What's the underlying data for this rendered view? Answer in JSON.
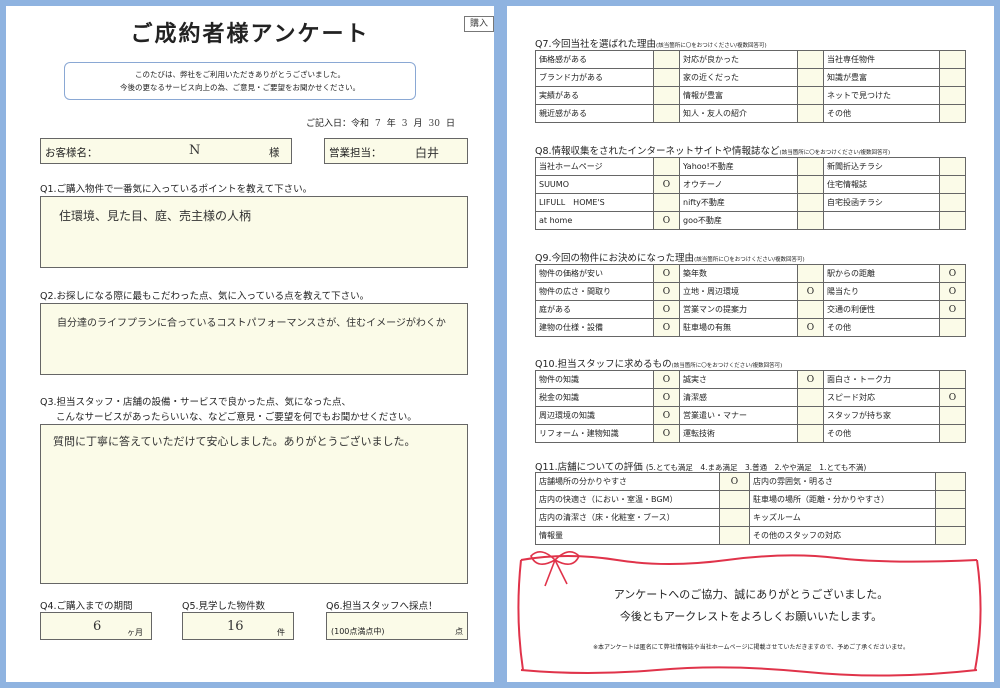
{
  "left": {
    "title": "ご成約者様アンケート",
    "tag": "購入",
    "intro": [
      "このたびは、弊社をご利用いただきありがとうございました。",
      "今後の更なるサービス向上の為、ご意見・ご要望をお聞かせください。"
    ],
    "date": {
      "label": "ご記入日：令和",
      "year": "7",
      "year_unit": "年",
      "month": "3",
      "month_unit": "月",
      "day": "30",
      "day_unit": "日"
    },
    "customer": {
      "label": "お客様名：",
      "value": "N",
      "suffix": "様"
    },
    "sales": {
      "label": "営業担当：",
      "value": "白井"
    },
    "q1": {
      "label": "Q1.ご購入物件で一番気に入っているポイントを教えて下さい。",
      "answer": "住環境、見た目、庭、売主様の人柄"
    },
    "q2": {
      "label": "Q2.お探しになる際に最もこだわった点、気に入っている点を教えて下さい。",
      "answer": "自分達のライフプランに合っているコストパフォーマンスさが、住むイメージがわくか"
    },
    "q3": {
      "label1": "Q3.担当スタッフ・店舗の設備・サービスで良かった点、気になった点、",
      "label2": "こんなサービスがあったらいいな、などご意見・ご要望を何でもお聞かせください。",
      "answer": "質問に丁寧に答えていただけて安心しました。ありがとうございました。"
    },
    "q4": {
      "label": "Q4.ご購入までの期間",
      "value": "6",
      "unit": "ヶ月"
    },
    "q5": {
      "label": "Q5.見学した物件数",
      "value": "16",
      "unit": "件"
    },
    "q6": {
      "label": "Q6.担当スタッフへ採点！",
      "note": "(100点満点中)",
      "unit": "点"
    }
  },
  "right": {
    "q7": {
      "title": "Q7.今回当社を選ばれた理由",
      "note": "(該当箇所に〇をおつけください/複数回答可)",
      "rows": [
        [
          "価格感がある",
          "",
          "対応が良かった",
          "",
          "当社専任物件",
          ""
        ],
        [
          "ブランド力がある",
          "",
          "家の近くだった",
          "",
          "知識が豊富",
          ""
        ],
        [
          "実績がある",
          "",
          "情報が豊富",
          "",
          "ネットで見つけた",
          ""
        ],
        [
          "親近感がある",
          "",
          "知人・友人の紹介",
          "",
          "その他",
          ""
        ]
      ]
    },
    "q8": {
      "title": "Q8.情報収集をされたインターネットサイトや情報誌など",
      "note": "(該当箇所に〇をおつけください/複数回答可)",
      "rows": [
        [
          "当社ホームページ",
          "",
          "Yahoo!不動産",
          "",
          "新聞折込チラシ",
          ""
        ],
        [
          "SUUMO",
          "O",
          "オウチーノ",
          "",
          "住宅情報誌",
          ""
        ],
        [
          "LIFULL　HOME'S",
          "",
          "nifty不動産",
          "",
          "自宅投函チラシ",
          ""
        ],
        [
          "at home",
          "O",
          "goo不動産",
          "",
          "",
          ""
        ]
      ]
    },
    "q9": {
      "title": "Q9.今回の物件にお決めになった理由",
      "note": "(該当箇所に〇をおつけください/複数回答可)",
      "rows": [
        [
          "物件の価格が安い",
          "O",
          "築年数",
          "",
          "駅からの距離",
          "O"
        ],
        [
          "物件の広さ・間取り",
          "O",
          "立地・周辺環境",
          "O",
          "陽当たり",
          "O"
        ],
        [
          "庭がある",
          "O",
          "営業マンの提案力",
          "",
          "交通の利便性",
          "O"
        ],
        [
          "建物の仕様・設備",
          "O",
          "駐車場の有無",
          "O",
          "その他",
          ""
        ]
      ]
    },
    "q10": {
      "title": "Q10.担当スタッフに求めるもの",
      "note": "(該当箇所に〇をおつけください/複数回答可)",
      "rows": [
        [
          "物件の知識",
          "O",
          "誠実さ",
          "O",
          "面白さ・トーク力",
          ""
        ],
        [
          "税金の知識",
          "O",
          "清潔感",
          "",
          "スピード対応",
          "O"
        ],
        [
          "周辺環境の知識",
          "O",
          "営業遣い・マナー",
          "",
          "スタッフが持ち家",
          ""
        ],
        [
          "リフォーム・建物知識",
          "O",
          "運転技術",
          "",
          "その他",
          ""
        ]
      ]
    },
    "q11": {
      "title": "Q11.店舗についての評価",
      "scale": "(5.とても満足　4.まあ満足　3.普通　2.やや満足　1.とても不満)",
      "rows": [
        [
          "店舗場所の分かりやすさ",
          "O",
          "店内の雰囲気・明るさ",
          ""
        ],
        [
          "店内の快適さ（におい・室温・BGM）",
          "",
          "駐車場の場所（距離・分かりやすさ）",
          ""
        ],
        [
          "店内の清潔さ（床・化粧室・ブース）",
          "",
          "キッズルーム",
          ""
        ],
        [
          "情報量",
          "",
          "その他のスタッフの対応",
          ""
        ]
      ]
    },
    "thanks": {
      "line1": "アンケートへのご協力、誠にありがとうございました。",
      "line2": "今後ともアークレストをよろしくお願いいたします。",
      "note": "※本アンケートは匿名にて弊社情報誌や当社ホームページに掲載させていただきますので、予めご了承くださいませ。"
    },
    "colors": {
      "ribbon": "#e0334a",
      "frame": "#8fb3e0",
      "answer_bg": "#fbfbe8"
    }
  }
}
